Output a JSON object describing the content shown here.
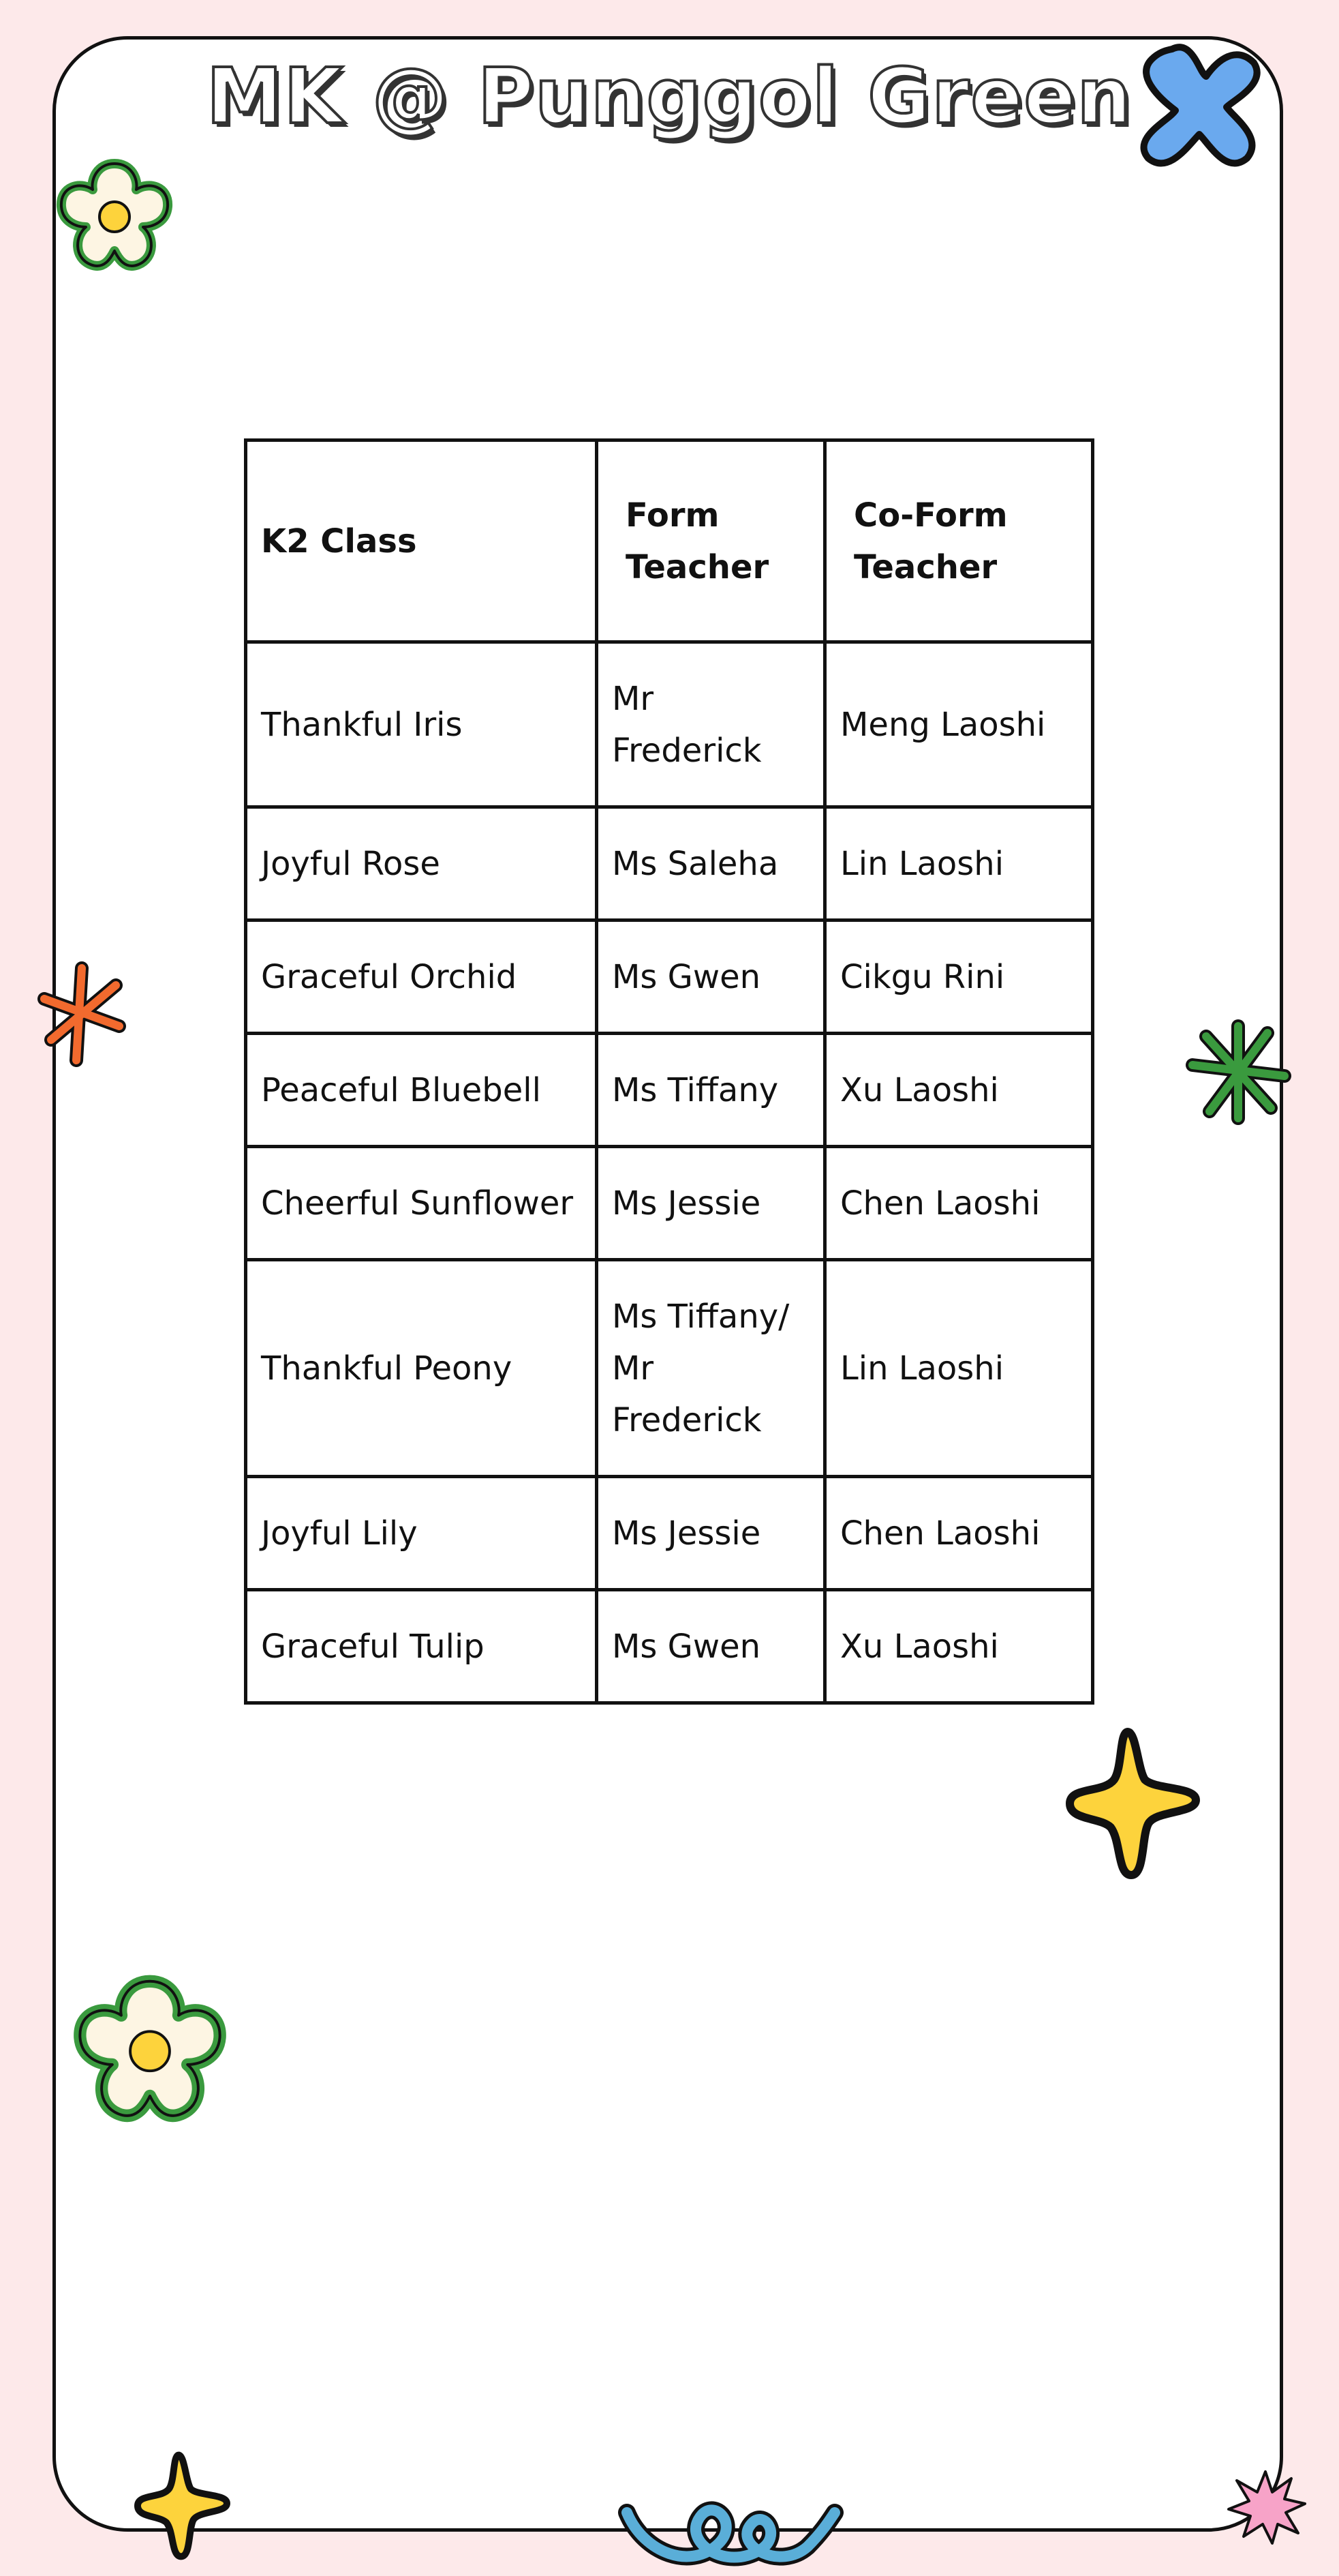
{
  "page": {
    "title": "MK @ Punggol Green"
  },
  "table": {
    "headers": [
      "K2 Class",
      "Form Teacher",
      "Co-Form Teacher"
    ],
    "rows": [
      [
        "Thankful Iris",
        "Mr Frederick",
        "Meng Laoshi"
      ],
      [
        "Joyful Rose",
        "Ms Saleha",
        "Lin Laoshi"
      ],
      [
        "Graceful Orchid",
        "Ms Gwen",
        "Cikgu Rini"
      ],
      [
        "Peaceful Bluebell",
        "Ms Tiffany",
        "Xu Laoshi"
      ],
      [
        "Cheerful Sunflower",
        "Ms Jessie",
        "Chen Laoshi"
      ],
      [
        "Thankful Peony",
        "Ms  Tiffany/ Mr Frederick",
        "Lin Laoshi"
      ],
      [
        "Joyful Lily",
        "Ms Jessie",
        "Chen Laoshi"
      ],
      [
        "Graceful Tulip",
        "Ms Gwen",
        "Xu Laoshi"
      ]
    ]
  },
  "colors": {
    "background": "#fde9ea",
    "card": "#ffffff",
    "outline": "#111111",
    "blue": "#6aa9ee",
    "green": "#3a9a3e",
    "yellow": "#fdd33c",
    "orange": "#f26a2e",
    "pink": "#f7a3c8",
    "teal": "#5aaed8",
    "cream": "#fdf5e3"
  },
  "decorations": [
    "blue-cross-icon",
    "flower-icon",
    "orange-asterisk-icon",
    "green-asterisk-icon",
    "yellow-star-icon",
    "flower-icon",
    "yellow-star-icon",
    "squiggle-icon",
    "pink-burst-icon"
  ]
}
